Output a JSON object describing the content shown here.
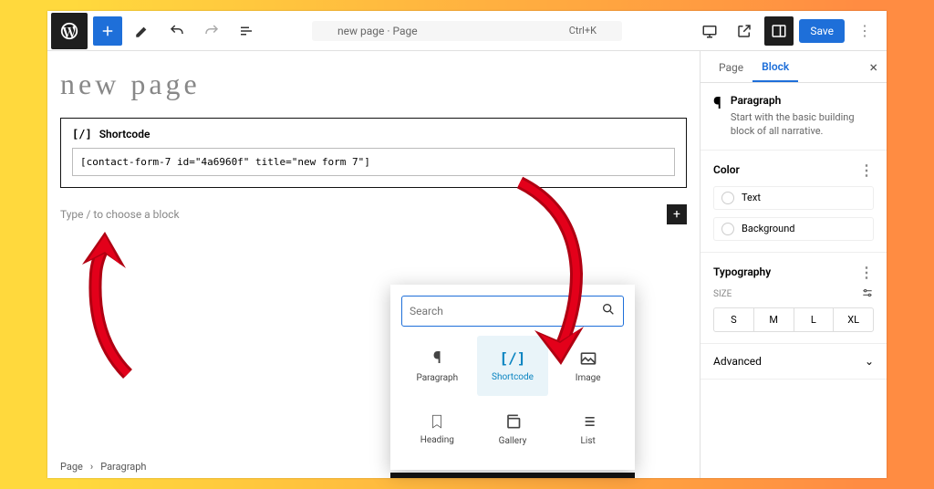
{
  "topbar": {
    "doc_title": "new page · Page",
    "shortcut": "Ctrl+K",
    "save_label": "Save"
  },
  "canvas": {
    "title": "new page",
    "shortcode_label": "Shortcode",
    "shortcode_value": "[contact-form-7 id=\"4a6960f\" title=\"new form 7\"]",
    "placeholder": "Type / to choose a block"
  },
  "breadcrumb": {
    "root": "Page",
    "leaf": "Paragraph"
  },
  "inserter": {
    "search_placeholder": "Search",
    "items": [
      "Paragraph",
      "Shortcode",
      "Image",
      "Heading",
      "Gallery",
      "List"
    ]
  },
  "sidebar": {
    "tabs": {
      "page": "Page",
      "block": "Block"
    },
    "blk_name": "Paragraph",
    "blk_desc": "Start with the basic building block of all narrative.",
    "color_header": "Color",
    "color_text": "Text",
    "color_bg": "Background",
    "typo_header": "Typography",
    "size_label": "SIZE",
    "sizes": [
      "S",
      "M",
      "L",
      "XL"
    ],
    "advanced": "Advanced"
  }
}
